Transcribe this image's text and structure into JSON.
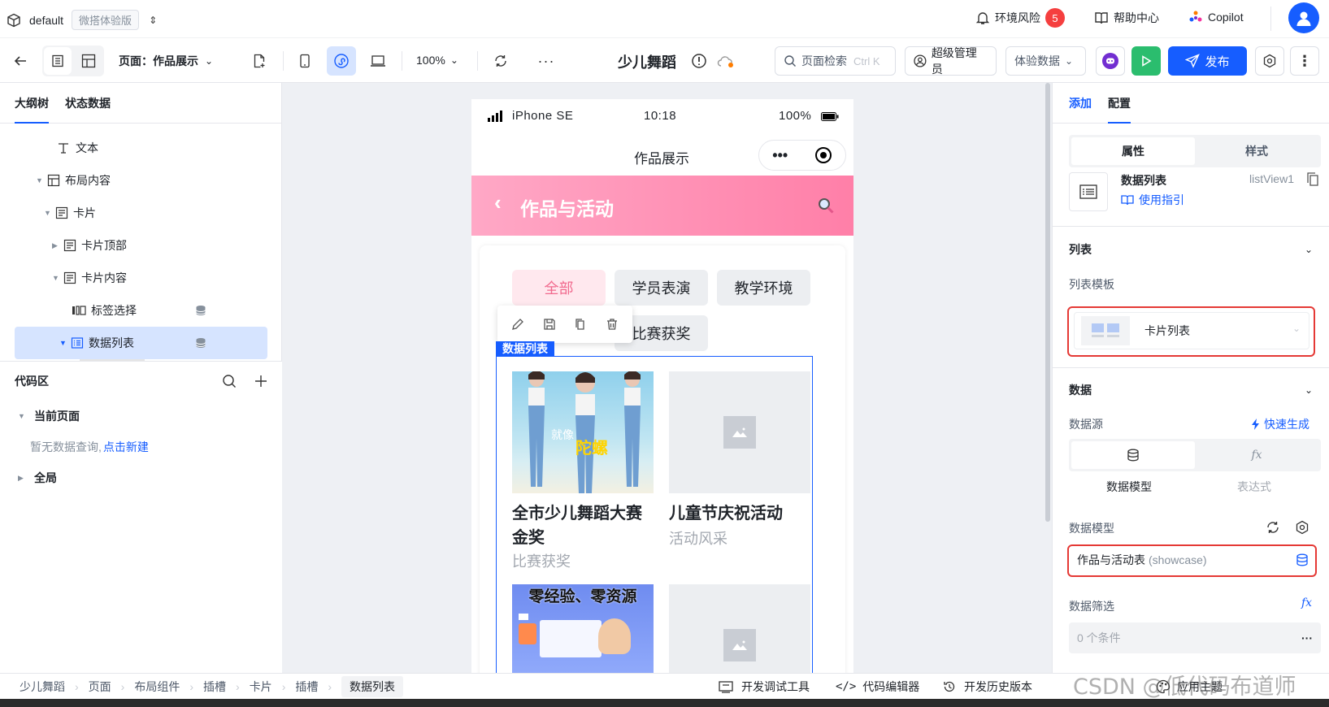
{
  "app": {
    "workspace": "default",
    "edition_badge": "微搭体验版",
    "env_risk_label": "环境风险",
    "env_risk_count": "5",
    "help_label": "帮助中心",
    "copilot_label": "Copilot"
  },
  "toolbar": {
    "page_prefix": "页面：",
    "page_name": "作品展示",
    "zoom": "100%",
    "app_title": "少儿舞蹈",
    "search_label": "页面检索",
    "search_shortcut": "Ctrl K",
    "admin_label": "超级管理员",
    "data_mode_label": "体验数据",
    "publish_label": "发布"
  },
  "left_panel": {
    "tabs": [
      "大纲树",
      "状态数据"
    ],
    "tree": [
      {
        "label": "文本",
        "icon": "text-icon"
      },
      {
        "label": "布局内容",
        "icon": "layout-icon"
      },
      {
        "label": "卡片",
        "icon": "card-icon"
      },
      {
        "label": "卡片顶部",
        "icon": "card-icon"
      },
      {
        "label": "卡片内容",
        "icon": "card-icon"
      },
      {
        "label": "标签选择",
        "icon": "tag-select-icon"
      },
      {
        "label": "数据列表",
        "icon": "list-icon"
      }
    ],
    "code_title": "代码区",
    "current_page": "当前页面",
    "empty_query": "暂无数据查询,",
    "create_link": "点击新建",
    "global": "全局"
  },
  "phone": {
    "carrier": "iPhone SE",
    "time": "10:18",
    "battery": "100%",
    "nav_title": "作品展示",
    "banner_title": "作品与活动",
    "tags": [
      "全部",
      "学员表演",
      "教学环境",
      "比赛获奖"
    ],
    "selection_label": "数据列表",
    "cards": [
      {
        "title": "全市少儿舞蹈大赛金奖",
        "category": "比赛获奖"
      },
      {
        "title": "儿童节庆祝活动",
        "category": "活动风采"
      }
    ],
    "image_text_1": "就像",
    "image_text_2": "陀螺",
    "image_text_3": "零经验、零资源"
  },
  "right_panel": {
    "tabs": [
      "添加",
      "配置"
    ],
    "seg": [
      "属性",
      "样式"
    ],
    "comp_name": "数据列表",
    "comp_id": "listView1",
    "guide_label": "使用指引",
    "list_section": "列表",
    "template_label": "列表模板",
    "template_value": "卡片列表",
    "data_section": "数据",
    "datasource_label": "数据源",
    "quick_gen": "快速生成",
    "ds_options": [
      "数据模型",
      "表达式"
    ],
    "model_label": "数据模型",
    "model_value": "作品与活动表",
    "model_code": "(showcase)",
    "filter_label": "数据筛选",
    "filter_value": "0 个条件"
  },
  "statusbar": {
    "breadcrumb": [
      "少儿舞蹈",
      "页面",
      "布局组件",
      "插槽",
      "卡片",
      "插槽",
      "数据列表"
    ],
    "dev_tools": "开发调试工具",
    "code_editor": "代码编辑器",
    "history": "开发历史版本",
    "theme": "应用主题",
    "watermark": "CSDN @低代码布道师"
  },
  "colors": {
    "primary": "#165dff",
    "selection": "#d6e4ff",
    "banner": "#ff8fb2",
    "run_green": "#2bbd6e",
    "highlight_red": "#e53935",
    "badge_red": "#f53f3f"
  }
}
